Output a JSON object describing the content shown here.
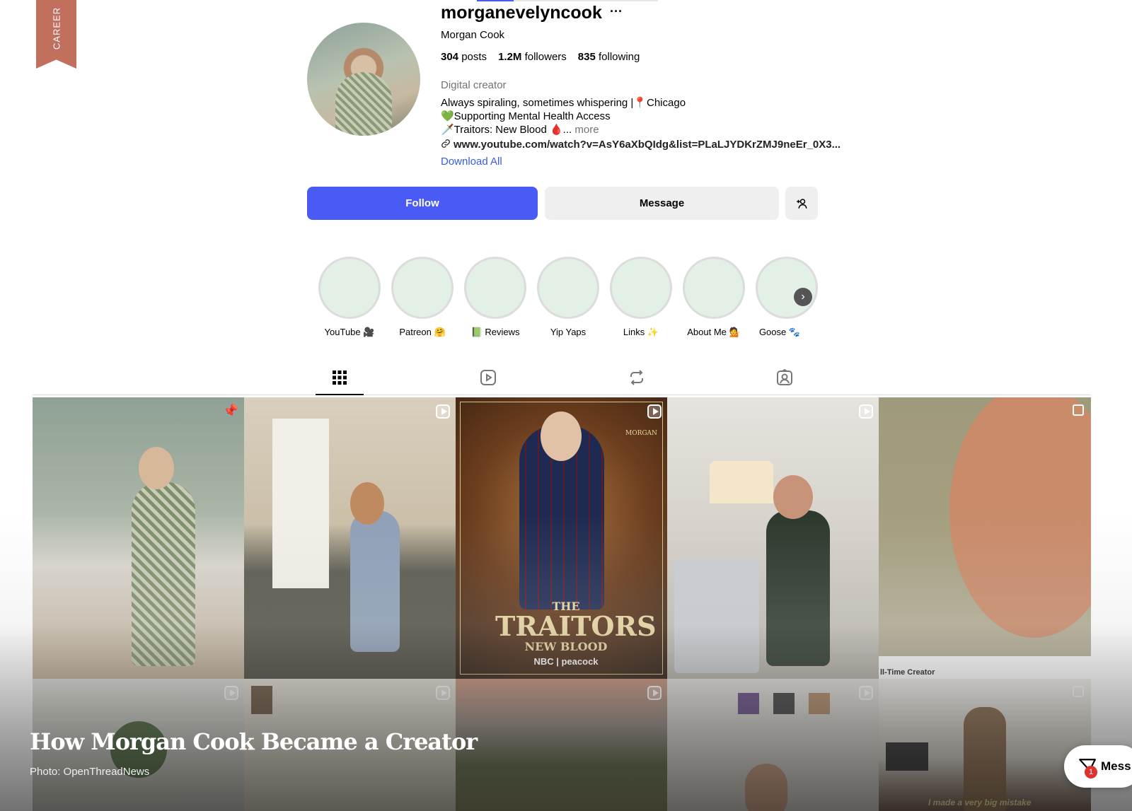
{
  "ribbon": {
    "label": "CAREER"
  },
  "profile": {
    "username": "morganevelyncook",
    "more_options": "···",
    "full_name": "Morgan Cook",
    "stats": [
      {
        "value": "304",
        "label": "posts"
      },
      {
        "value": "1.2M",
        "label": "followers"
      },
      {
        "value": "835",
        "label": "following"
      }
    ],
    "category": "Digital creator",
    "bio_lines": [
      "Always spiraling, sometimes whispering |📍Chicago",
      "💚Supporting Mental Health Access",
      "🗡️Traitors: New Blood 🩸..."
    ],
    "bio_more": "more",
    "link": "www.youtube.com/watch?v=AsY6aXbQIdg&list=PLaLJYDKrZMJ9neEr_0X3...",
    "download_all": "Download All"
  },
  "actions": {
    "follow": "Follow",
    "message": "Message"
  },
  "highlights": [
    {
      "label": "YouTube 🎥"
    },
    {
      "label": "Patreon 🤗"
    },
    {
      "label": "📗 Reviews"
    },
    {
      "label": "Yip Yaps"
    },
    {
      "label": "Links ✨"
    },
    {
      "label": "About Me 💁"
    },
    {
      "label": "Goose 🐾"
    }
  ],
  "posts": {
    "traitors": {
      "the": "THE",
      "title": "TRAITORS",
      "sub": "NEW BLOOD",
      "network": "NBC | peacock",
      "tag": "MORGAN"
    },
    "caption_1": "ll-Time Creator",
    "caption_2": "I made a very big mistake"
  },
  "overlay": {
    "headline": "How Morgan Cook Became a Creator",
    "credit": "Photo: OpenThreadNews"
  },
  "fab": {
    "label": "Mess",
    "badge": "1"
  },
  "colors": {
    "accent": "#4a5bf5",
    "ribbon": "#c0705c",
    "link": "#3b5bdb"
  }
}
